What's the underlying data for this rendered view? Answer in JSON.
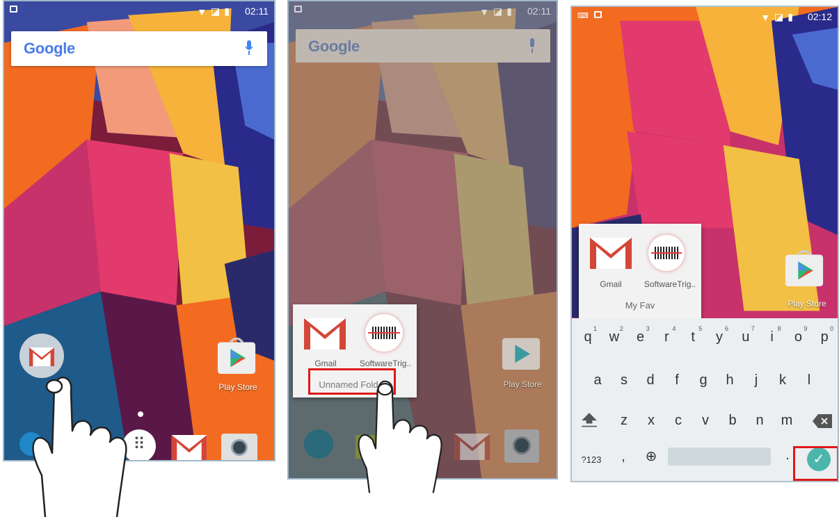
{
  "screen1": {
    "status_time": "02:11",
    "search_logo": "Google",
    "gmail_drag_icon": "gmail-icon",
    "play_store_label": "Play Store",
    "dock": [
      "phone-icon",
      "app-drawer-icon",
      "gmail-icon",
      "camera-icon"
    ]
  },
  "screen2": {
    "status_time": "02:11",
    "search_logo": "Google",
    "folder": {
      "apps": [
        {
          "label": "Gmail"
        },
        {
          "label": "SoftwareTrig.."
        }
      ],
      "name": "Unnamed Fold"
    },
    "play_store_label": "Play Store"
  },
  "screen3": {
    "status_time": "02:12",
    "folder": {
      "apps": [
        {
          "label": "Gmail"
        },
        {
          "label": "SoftwareTrig.."
        }
      ],
      "name": "My Fav"
    },
    "play_store_label": "Play Store",
    "keyboard": {
      "row1": [
        {
          "k": "q",
          "n": "1"
        },
        {
          "k": "w",
          "n": "2"
        },
        {
          "k": "e",
          "n": "3"
        },
        {
          "k": "r",
          "n": "4"
        },
        {
          "k": "t",
          "n": "5"
        },
        {
          "k": "y",
          "n": "6"
        },
        {
          "k": "u",
          "n": "7"
        },
        {
          "k": "i",
          "n": "8"
        },
        {
          "k": "o",
          "n": "9"
        },
        {
          "k": "p",
          "n": "0"
        }
      ],
      "row2": [
        "a",
        "s",
        "d",
        "f",
        "g",
        "h",
        "j",
        "k",
        "l"
      ],
      "row3": [
        "z",
        "x",
        "c",
        "v",
        "b",
        "n",
        "m"
      ],
      "symbols_key": "?123",
      "comma_key": ",",
      "period_key": "."
    }
  },
  "colors": {
    "highlight": "#e01818",
    "done_key": "#4db6ac"
  }
}
